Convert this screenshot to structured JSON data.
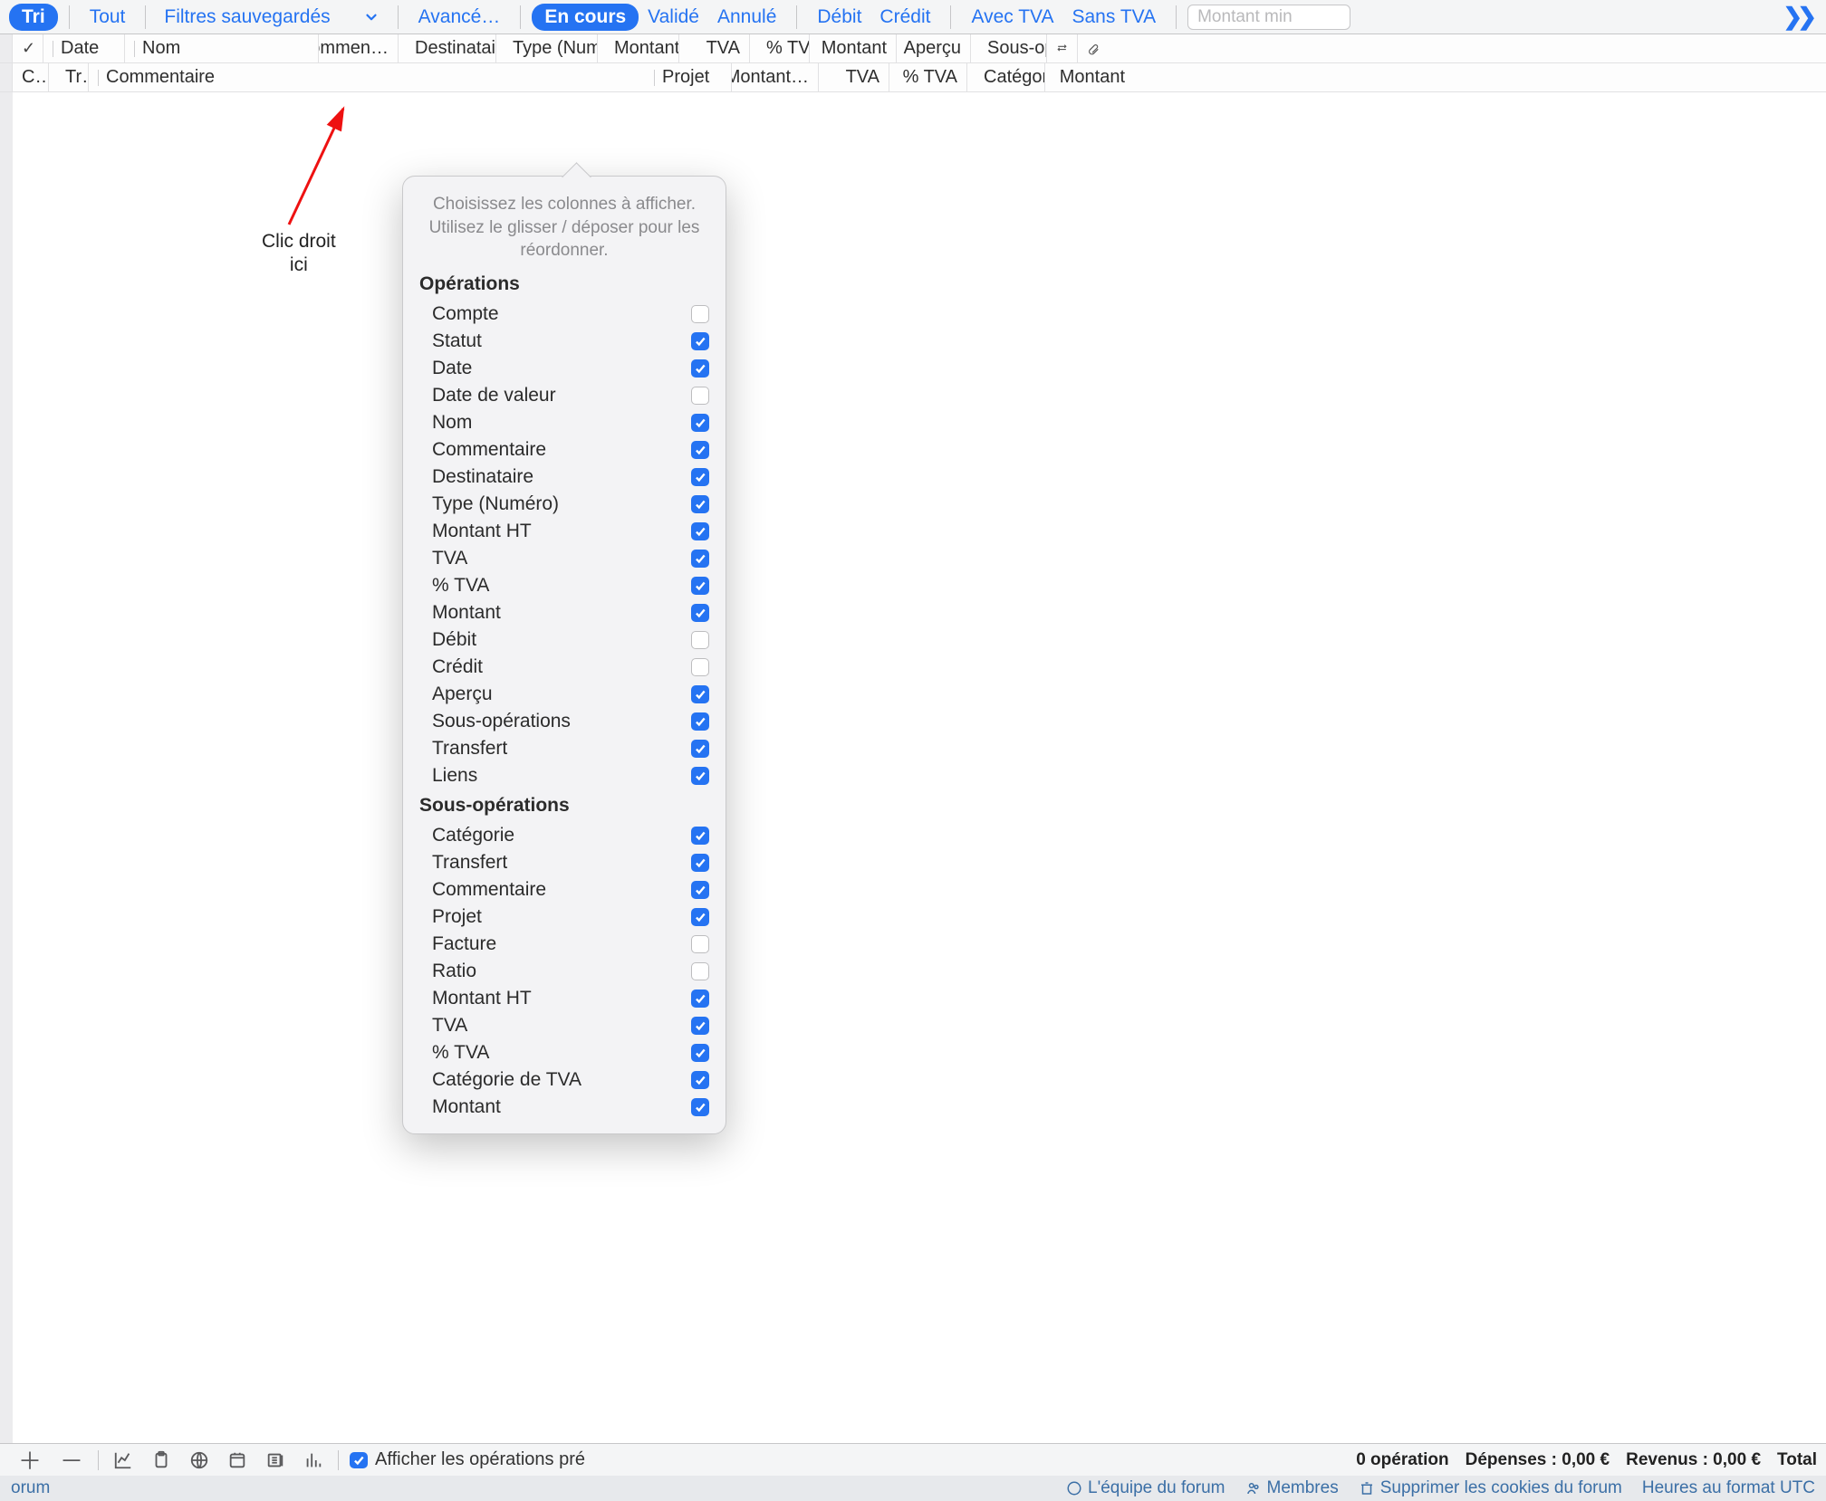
{
  "toolbar": {
    "tri": "Tri",
    "tout": "Tout",
    "saved_filters": "Filtres sauvegardés",
    "advanced": "Avancé…",
    "en_cours": "En cours",
    "valide": "Validé",
    "annule": "Annulé",
    "debit": "Débit",
    "credit": "Crédit",
    "avec_tva": "Avec TVA",
    "sans_tva": "Sans TVA",
    "montant_min_placeholder": "Montant min",
    "more_glyphs": "❯❯"
  },
  "headers_row1": {
    "date": "Date",
    "nom": "Nom",
    "commen": "Commen…",
    "destinataire": "Destinataire",
    "type": "Type (Numér…",
    "montant1": "Montant…",
    "tva": "TVA",
    "pct_tva": "% TVA",
    "montant2": "Montant",
    "apercu": "Aperçu",
    "sous_op": "Sous-op…"
  },
  "headers_row2": {
    "c": "C…",
    "tr": "Tr…",
    "commentaire": "Commentaire",
    "projet": "Projet",
    "montant": "Montant…",
    "tva": "TVA",
    "pct_tva": "% TVA",
    "categori": "Catégori…",
    "montant2": "Montant"
  },
  "annotation": {
    "line1": "Clic droit",
    "line2": "ici"
  },
  "popover": {
    "instructions": "Choisissez les colonnes à afficher. Utilisez le glisser / déposer pour les réordonner.",
    "section_ops": "Opérations",
    "section_subops": "Sous-opérations",
    "ops": [
      {
        "label": "Compte",
        "checked": false
      },
      {
        "label": "Statut",
        "checked": true
      },
      {
        "label": "Date",
        "checked": true
      },
      {
        "label": "Date de valeur",
        "checked": false
      },
      {
        "label": "Nom",
        "checked": true
      },
      {
        "label": "Commentaire",
        "checked": true
      },
      {
        "label": "Destinataire",
        "checked": true
      },
      {
        "label": "Type (Numéro)",
        "checked": true
      },
      {
        "label": "Montant HT",
        "checked": true
      },
      {
        "label": "TVA",
        "checked": true
      },
      {
        "label": "% TVA",
        "checked": true
      },
      {
        "label": "Montant",
        "checked": true
      },
      {
        "label": "Débit",
        "checked": false
      },
      {
        "label": "Crédit",
        "checked": false
      },
      {
        "label": "Aperçu",
        "checked": true
      },
      {
        "label": "Sous-opérations",
        "checked": true
      },
      {
        "label": "Transfert",
        "checked": true
      },
      {
        "label": "Liens",
        "checked": true
      }
    ],
    "subops": [
      {
        "label": "Catégorie",
        "checked": true
      },
      {
        "label": "Transfert",
        "checked": true
      },
      {
        "label": "Commentaire",
        "checked": true
      },
      {
        "label": "Projet",
        "checked": true
      },
      {
        "label": "Facture",
        "checked": false
      },
      {
        "label": "Ratio",
        "checked": false
      },
      {
        "label": "Montant HT",
        "checked": true
      },
      {
        "label": "TVA",
        "checked": true
      },
      {
        "label": "% TVA",
        "checked": true
      },
      {
        "label": "Catégorie de TVA",
        "checked": true
      },
      {
        "label": "Montant",
        "checked": true
      }
    ]
  },
  "bottombar": {
    "show_forecast": "Afficher les opérations pré",
    "op_count": "0 opération",
    "depenses": "Dépenses : 0,00 €",
    "revenus": "Revenus : 0,00 €",
    "total": "Total"
  },
  "footer": {
    "forum": "orum",
    "team": "L'équipe du forum",
    "members": "Membres",
    "cookies": "Supprimer les cookies du forum",
    "hours": "Heures au format UTC"
  }
}
